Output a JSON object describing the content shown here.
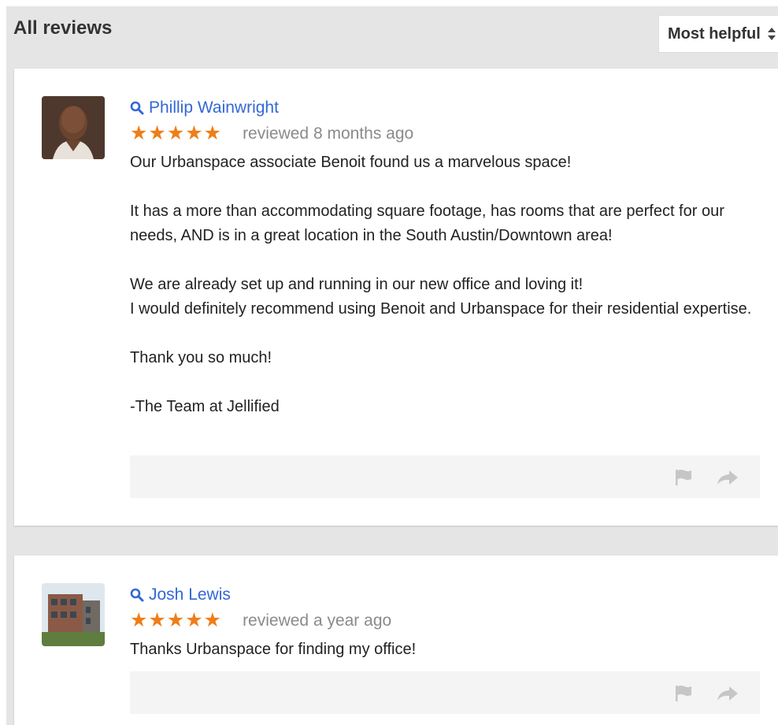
{
  "header": {
    "title": "All reviews"
  },
  "sort": {
    "selected": "Most helpful",
    "icon": "sort-arrows-icon"
  },
  "colors": {
    "link": "#3367d6",
    "star": "#ef7e18",
    "muted": "#8a8a8a",
    "panel": "#e5e5e5"
  },
  "reviews": [
    {
      "author": "Phillip Wainwright",
      "stars": "★★★★★",
      "rating": 5,
      "when": "reviewed 8 months ago",
      "lines": [
        "Our Urbanspace associate Benoit found us a marvelous space!",
        "It has a more than accommodating square footage, has rooms that are perfect for our needs, AND is in a great location in the South Austin/Downtown area!",
        "We are already set up and running in our new office and loving it!",
        "I would definitely recommend using Benoit and Urbanspace for their residential expertise.",
        "Thank you so much!",
        "-The Team at Jellified"
      ]
    },
    {
      "author": "Josh Lewis",
      "stars": "★★★★★",
      "rating": 5,
      "when": "reviewed a year ago",
      "lines": [
        "Thanks Urbanspace for finding my office!"
      ]
    }
  ]
}
